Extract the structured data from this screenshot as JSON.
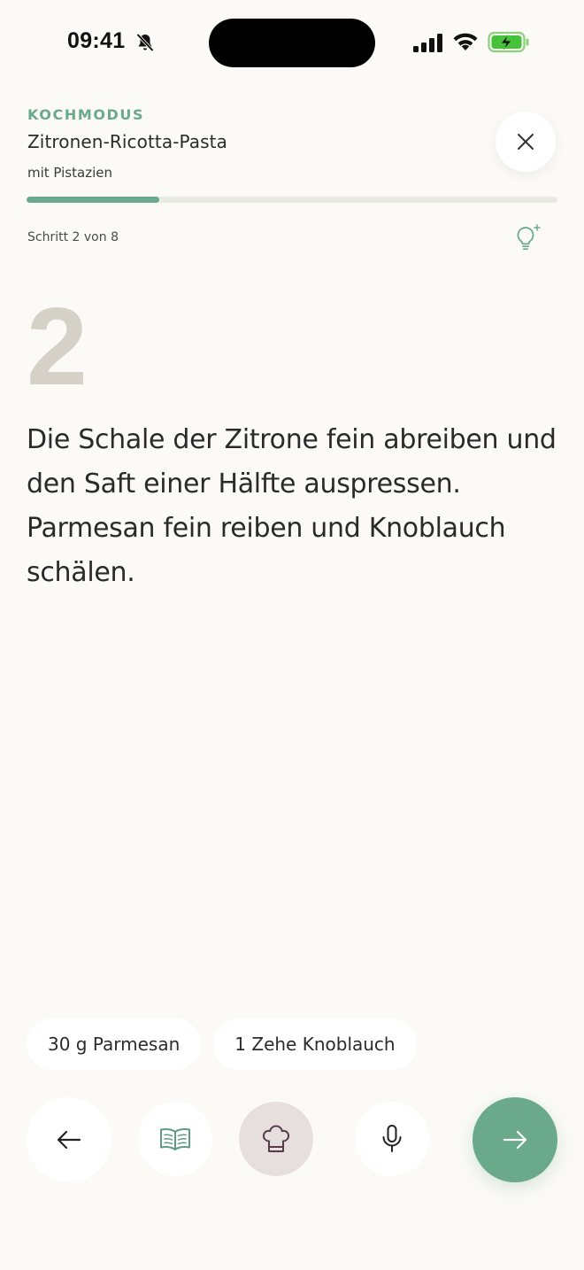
{
  "status_bar": {
    "time": "09:41"
  },
  "header": {
    "mode_label": "KOCHMODUS",
    "recipe_title": "Zitronen-Ricotta-Pasta",
    "recipe_subtitle": "mit Pistazien",
    "progress_fraction": 0.25,
    "step_counter": "Schritt 2 von 8"
  },
  "step": {
    "number": "2",
    "text": "Die Schale der Zitrone fein abreiben und den Saft einer Hälfte auspressen. Parmesan fein reiben und Knoblauch schälen."
  },
  "ingredients": [
    "30 g Parmesan",
    "1 Zehe Knoblauch"
  ],
  "toolbar": {
    "icons": [
      "arrow-left-icon",
      "open-book-icon",
      "chef-hat-icon",
      "microphone-icon",
      "arrow-right-icon"
    ]
  },
  "colors": {
    "accent": "#6aa98b",
    "background": "#fbfaf6",
    "step_number": "#d5d1c8",
    "chef_button_bg": "#e6dfdd",
    "chef_icon": "#5a3a4a"
  }
}
